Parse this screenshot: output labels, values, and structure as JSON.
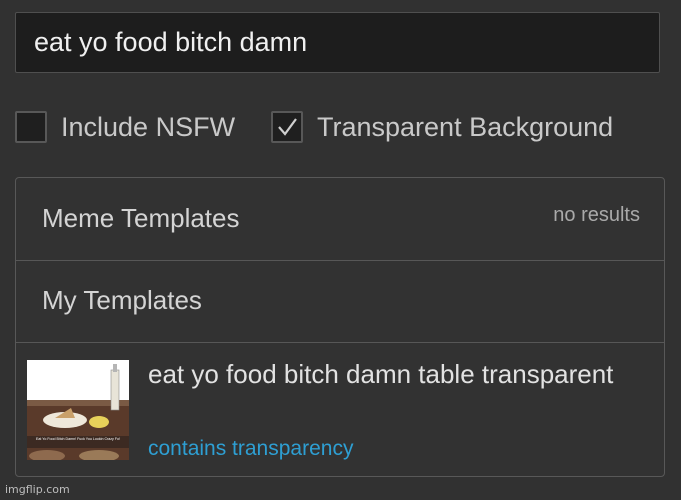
{
  "search": {
    "value": "eat yo food bitch damn"
  },
  "options": {
    "include_nsfw": {
      "label": "Include NSFW",
      "checked": false
    },
    "transparent_bg": {
      "label": "Transparent Background",
      "checked": true
    }
  },
  "sections": {
    "meme_templates": {
      "title": "Meme Templates",
      "status": "no results"
    },
    "my_templates": {
      "title": "My Templates"
    }
  },
  "result": {
    "title": "eat yo food bitch damn table transparent",
    "subtitle": "contains transparency",
    "thumbnail_caption": "Eat Yo Food Bitch Damn! Fuck You Lookin Crazy Fo!"
  },
  "watermark": "imgflip.com",
  "colors": {
    "background": "#313131",
    "link": "#2e9fd3"
  }
}
